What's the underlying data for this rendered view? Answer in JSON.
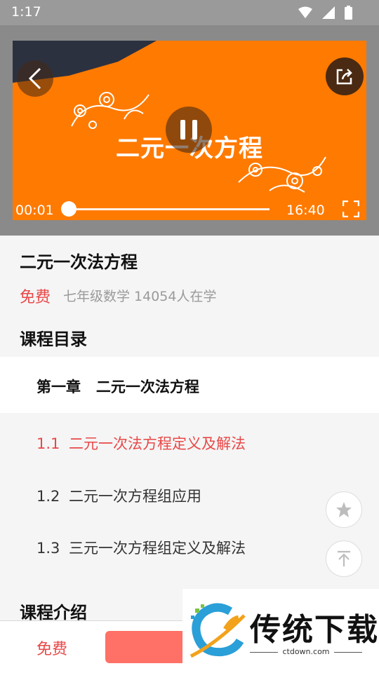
{
  "status_bar": {
    "time": "1:17"
  },
  "player": {
    "video_title_text": "二元一次方程",
    "current_time": "00:01",
    "total_time": "16:40",
    "progress": 0.001,
    "accent_color": "#ff7a00"
  },
  "course": {
    "title": "二元一次法方程",
    "price": "免费",
    "meta": "七年级数学 14054人在学"
  },
  "catalog": {
    "heading": "课程目录",
    "chapter": "第一章   二元一次法方程",
    "lessons": [
      {
        "num": "1.1",
        "title": "二元一次法方程定义及解法",
        "active": true
      },
      {
        "num": "1.2",
        "title": "二元一次方程组应用",
        "active": false
      },
      {
        "num": "1.3",
        "title": "三元一次方程组定义及解法",
        "active": false
      }
    ]
  },
  "intro": {
    "heading": "课程介绍"
  },
  "bottom_bar": {
    "price": "免费"
  },
  "watermark": {
    "brand": "传统下载",
    "domain": "ctdown.com"
  },
  "colors": {
    "accent_red": "#e94848",
    "cta": "#ff7066"
  }
}
